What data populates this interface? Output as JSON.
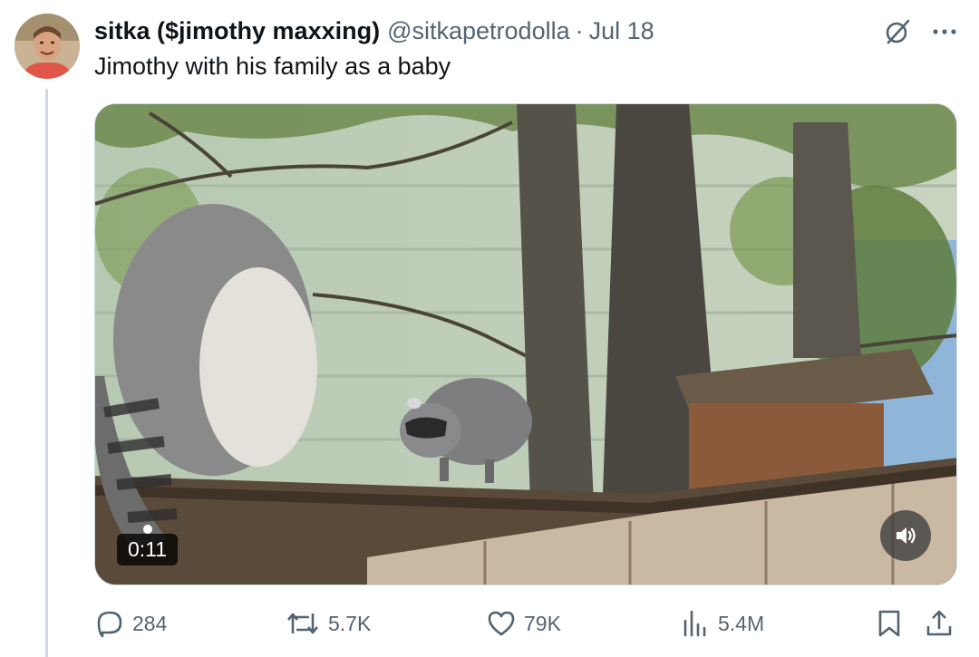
{
  "tweet": {
    "display_name": "sitka ($jimothy maxxing)",
    "handle": "@sitkapetrodolla",
    "separator": "·",
    "date": "Jul 18",
    "text": "Jimothy with his family as a baby"
  },
  "media": {
    "type": "video",
    "time": "0:11",
    "description_icon": "raccoon-video-thumbnail"
  },
  "actions": {
    "replies": "284",
    "reposts": "5.7K",
    "likes": "79K",
    "views": "5.4M"
  },
  "icons": {
    "grok": "grok-icon",
    "more": "more-icon",
    "reply": "reply-icon",
    "repost": "repost-icon",
    "like": "heart-icon",
    "views": "views-icon",
    "bookmark": "bookmark-icon",
    "share": "share-icon",
    "sound": "speaker-icon"
  },
  "colors": {
    "text_primary": "#0f1419",
    "text_secondary": "#536471",
    "border": "#cfd9de"
  }
}
